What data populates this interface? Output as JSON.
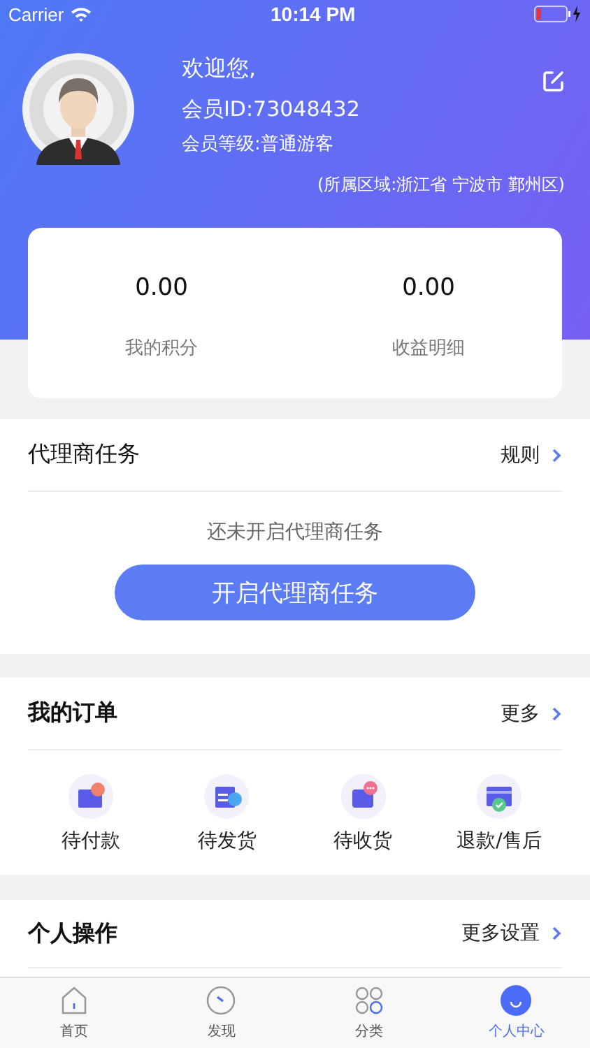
{
  "status_bar": {
    "carrier": "Carrier",
    "time": "10:14 PM"
  },
  "profile": {
    "greeting": "欢迎您,",
    "member_id": "会员ID:73048432",
    "member_level": "会员等级:普通游客",
    "region": "(所属区域:浙江省 宁波市 鄞州区)"
  },
  "stats": [
    {
      "value": "0.00",
      "label": "我的积分"
    },
    {
      "value": "0.00",
      "label": "收益明细"
    }
  ],
  "agent_tasks": {
    "title": "代理商任务",
    "link": "规则",
    "message": "还未开启代理商任务",
    "button": "开启代理商任务"
  },
  "orders": {
    "title": "我的订单",
    "link": "更多",
    "items": [
      {
        "kind": "payment",
        "label": "待付款"
      },
      {
        "kind": "shipping",
        "label": "待发货"
      },
      {
        "kind": "receiving",
        "label": "待收货"
      },
      {
        "kind": "refund",
        "label": "退款/售后"
      }
    ]
  },
  "operations": {
    "title": "个人操作",
    "link": "更多设置"
  },
  "tabs": [
    {
      "kind": "home",
      "label": "首页",
      "selected": false
    },
    {
      "kind": "discover",
      "label": "发现",
      "selected": false
    },
    {
      "kind": "category",
      "label": "分类",
      "selected": false
    },
    {
      "kind": "profile",
      "label": "个人中心",
      "selected": true
    }
  ]
}
